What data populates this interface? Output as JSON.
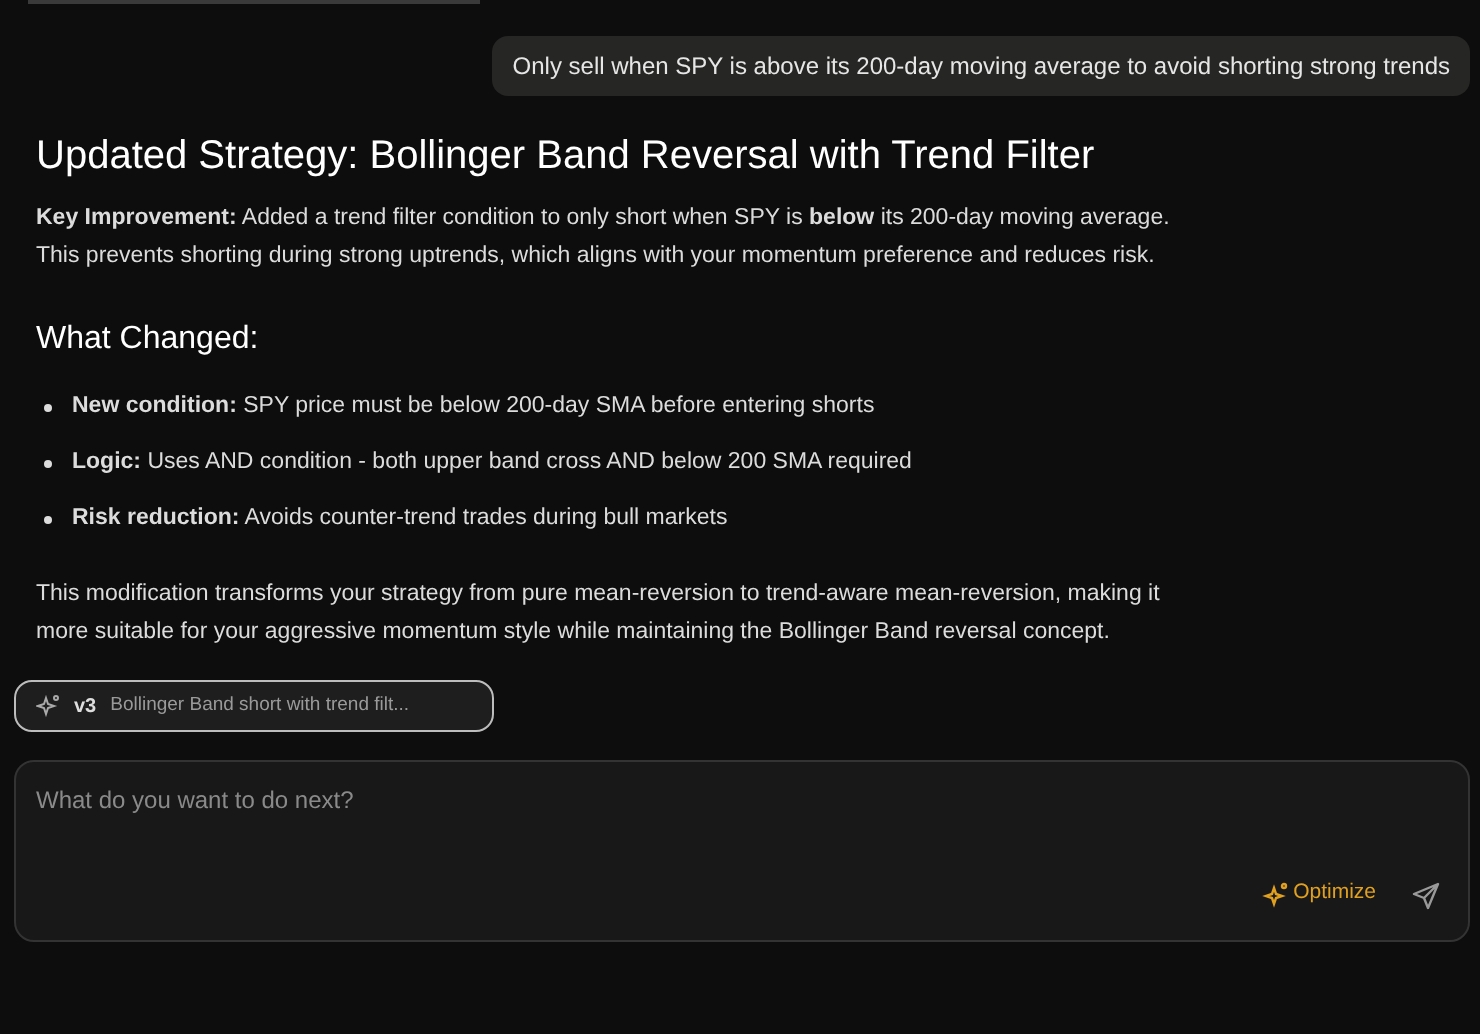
{
  "user_message": "Only sell when SPY is above its 200-day moving average to avoid shorting strong trends",
  "response": {
    "title": "Updated Strategy: Bollinger Band Reversal with Trend Filter",
    "intro": "**Key Improvement:** Added a trend filter condition to only short when SPY is **below** its 200-day moving average. This prevents shorting during strong uptrends, which aligns with your momentum preference and reduces risk.",
    "section_title": "What Changed:",
    "bullets": [
      "**New condition:** SPY price must be below 200-day SMA before entering shorts",
      "**Logic:** Uses AND condition - both upper band cross AND below 200 SMA required",
      "**Risk reduction:** Avoids counter-trend trades during bull markets"
    ],
    "outro": "This modification transforms your strategy from pure mean-reversion to trend-aware mean-reversion, making it more suitable for your aggressive momentum style while maintaining the Bollinger Band reversal concept."
  },
  "version_chip": {
    "version": "v3",
    "label": "Bollinger Band short with trend filt..."
  },
  "composer": {
    "placeholder": "What do you want to do next?",
    "optimize_label": "Optimize"
  }
}
